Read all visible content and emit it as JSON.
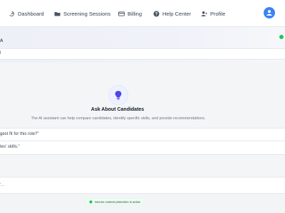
{
  "nav": {
    "items": [
      {
        "label": "Dashboard",
        "icon": "dashboard-icon"
      },
      {
        "label": "Screening Sessions",
        "icon": "folder-icon"
      },
      {
        "label": "Billing",
        "icon": "card-icon"
      },
      {
        "label": "Help Center",
        "icon": "help-icon"
      },
      {
        "label": "Profile",
        "icon": "user-icon"
      }
    ],
    "avatar_icon": "user-avatar-icon"
  },
  "panel": {
    "title": "A",
    "status_color": "#22c55e",
    "input_text": "l"
  },
  "empty_state": {
    "icon": "lightbulb-icon",
    "title": "Ask About Candidates",
    "description": "The AI assistant can help compare candidates, identify specific skills, and provide recommendations."
  },
  "suggestions": [
    {
      "text": "gest fit for this role?\""
    },
    {
      "text": "tes' skills.\""
    }
  ],
  "message_input": {
    "placeholder": "'..."
  },
  "footer": {
    "security_text": "Secure content protection is active"
  },
  "colors": {
    "accent": "#3b82f6",
    "success": "#22c55e"
  }
}
